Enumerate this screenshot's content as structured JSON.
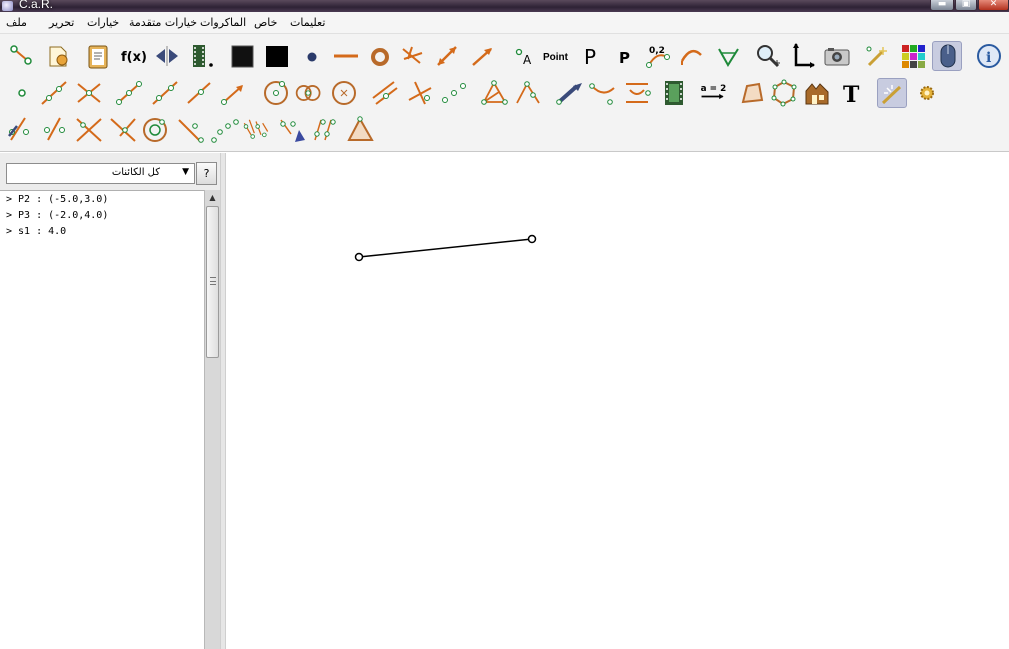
{
  "window": {
    "title": "C.a.R.",
    "buttons": {
      "minimize": "▬",
      "maximize": "▣",
      "close": "✕"
    }
  },
  "menu": {
    "file": "ملف",
    "edit": "تحرير",
    "options": "خيارات",
    "advanced_options": "خيارات متقدمة",
    "macros": "الماكروات",
    "special": "خاص",
    "help": "تعليمات"
  },
  "toolbar": {
    "point_text_label": "Point",
    "coords_label": "0,2",
    "fx_label": "f(x)",
    "assign_label": "a = 2",
    "text_tool_label": "T",
    "info_label": "i",
    "p_label": "P",
    "a_label": "A"
  },
  "left_panel": {
    "object_filter": "كل الكائنات",
    "help_button": "?",
    "objects": [
      "> P2 : (-5.0,3.0)",
      "> P3 : (-2.0,4.0)",
      "> s1 : 4.0"
    ]
  },
  "colors": {
    "accent_orange": "#d46a1a",
    "accent_green": "#1f8a3a",
    "title_bar": "#3b2d40"
  }
}
